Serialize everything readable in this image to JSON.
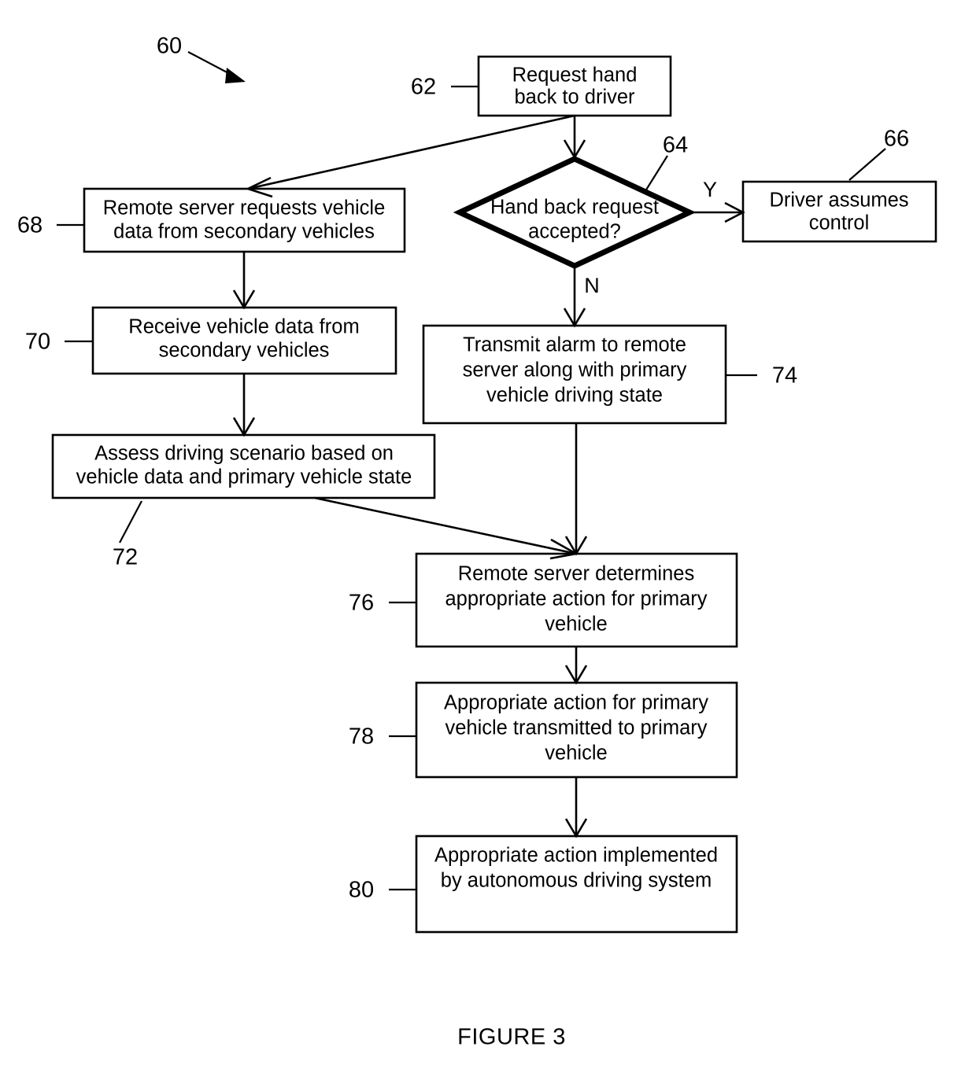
{
  "figure": {
    "caption": "FIGURE 3",
    "diagram_ref": "60"
  },
  "nodes": [
    {
      "id": "n62",
      "ref": "62",
      "type": "process",
      "lines": [
        "Request hand",
        "back to driver"
      ]
    },
    {
      "id": "n64",
      "ref": "64",
      "type": "decision",
      "lines": [
        "Hand back request",
        "accepted?"
      ]
    },
    {
      "id": "n66",
      "ref": "66",
      "type": "process",
      "lines": [
        "Driver assumes",
        "control"
      ]
    },
    {
      "id": "n68",
      "ref": "68",
      "type": "process",
      "lines": [
        "Remote server requests vehicle",
        "data from secondary vehicles"
      ]
    },
    {
      "id": "n70",
      "ref": "70",
      "type": "process",
      "lines": [
        "Receive vehicle data from",
        "secondary vehicles"
      ]
    },
    {
      "id": "n72",
      "ref": "72",
      "type": "process",
      "lines": [
        "Assess driving scenario based on",
        "vehicle data and primary vehicle state"
      ]
    },
    {
      "id": "n74",
      "ref": "74",
      "type": "process",
      "lines": [
        "Transmit alarm to remote",
        "server along with primary",
        "vehicle driving state"
      ]
    },
    {
      "id": "n76",
      "ref": "76",
      "type": "process",
      "lines": [
        "Remote server determines",
        "appropriate action for primary",
        "vehicle"
      ]
    },
    {
      "id": "n78",
      "ref": "78",
      "type": "process",
      "lines": [
        "Appropriate action for primary",
        "vehicle transmitted to primary",
        "vehicle"
      ]
    },
    {
      "id": "n80",
      "ref": "80",
      "type": "process",
      "lines": [
        "Appropriate action implemented",
        "by autonomous driving system"
      ]
    }
  ],
  "branch_labels": {
    "yes": "Y",
    "no": "N"
  },
  "colors": {
    "stroke": "#000000",
    "fill": "#ffffff"
  }
}
